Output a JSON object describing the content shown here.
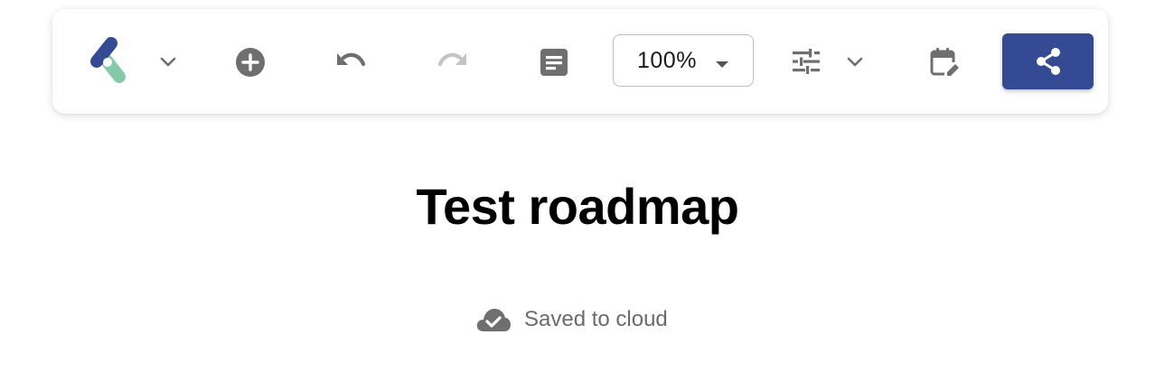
{
  "toolbar": {
    "logo_icon": "app-logo-icon",
    "logo_menu_icon": "chevron-down-icon",
    "add_icon": "add-circle-icon",
    "undo_icon": "undo-icon",
    "redo_icon": "redo-icon",
    "notes_icon": "notes-icon",
    "zoom": {
      "value": "100%",
      "caret_icon": "caret-down-icon"
    },
    "settings_icon": "sliders-icon",
    "settings_menu_icon": "chevron-down-icon",
    "calendar_icon": "calendar-edit-icon",
    "share_icon": "share-icon"
  },
  "document": {
    "title": "Test roadmap"
  },
  "status": {
    "icon": "cloud-done-icon",
    "text": "Saved to cloud"
  },
  "colors": {
    "brand_primary": "#344a92",
    "brand_secondary": "#86c9a8",
    "icon_gray": "#6f6f6f",
    "icon_disabled": "#c4c4c4"
  }
}
